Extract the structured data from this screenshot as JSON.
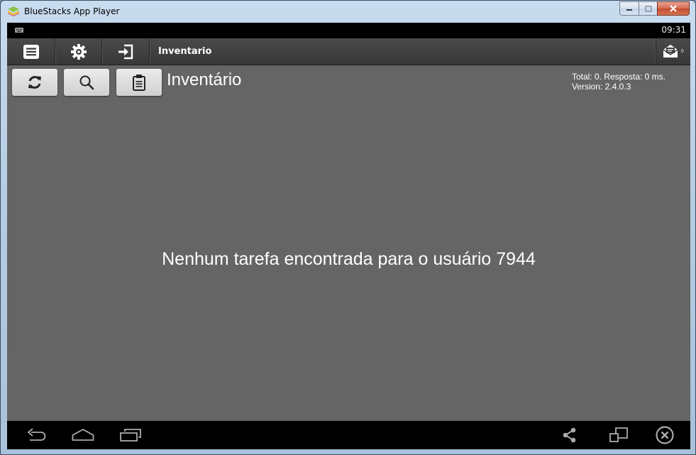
{
  "window": {
    "title": "BlueStacks App Player"
  },
  "statusbar": {
    "time": "09:31"
  },
  "actionbar": {
    "title": "Inventario",
    "mail_count": "0"
  },
  "page": {
    "heading": "Inventário",
    "total_line": "Total: 0. Resposta: 0 ms.",
    "version_line": "Version: 2.4.0.3"
  },
  "content": {
    "empty_message": "Nenhum tarefa encontrada para o usuário 7944"
  },
  "icons": {
    "actionbar": [
      "menu-list-icon",
      "settings-gear-icon",
      "login-icon",
      "mail-icon"
    ],
    "toolbar": [
      "refresh-icon",
      "search-icon",
      "clipboard-icon"
    ],
    "navbar": [
      "back-icon",
      "home-icon",
      "recent-apps-icon",
      "share-icon",
      "screen-rotate-icon",
      "close-circle-icon"
    ]
  },
  "colors": {
    "screen_bg": "#656565",
    "actionbar_bg": "#3f3f3f",
    "bar_bg": "#000000",
    "text": "#ffffff"
  }
}
